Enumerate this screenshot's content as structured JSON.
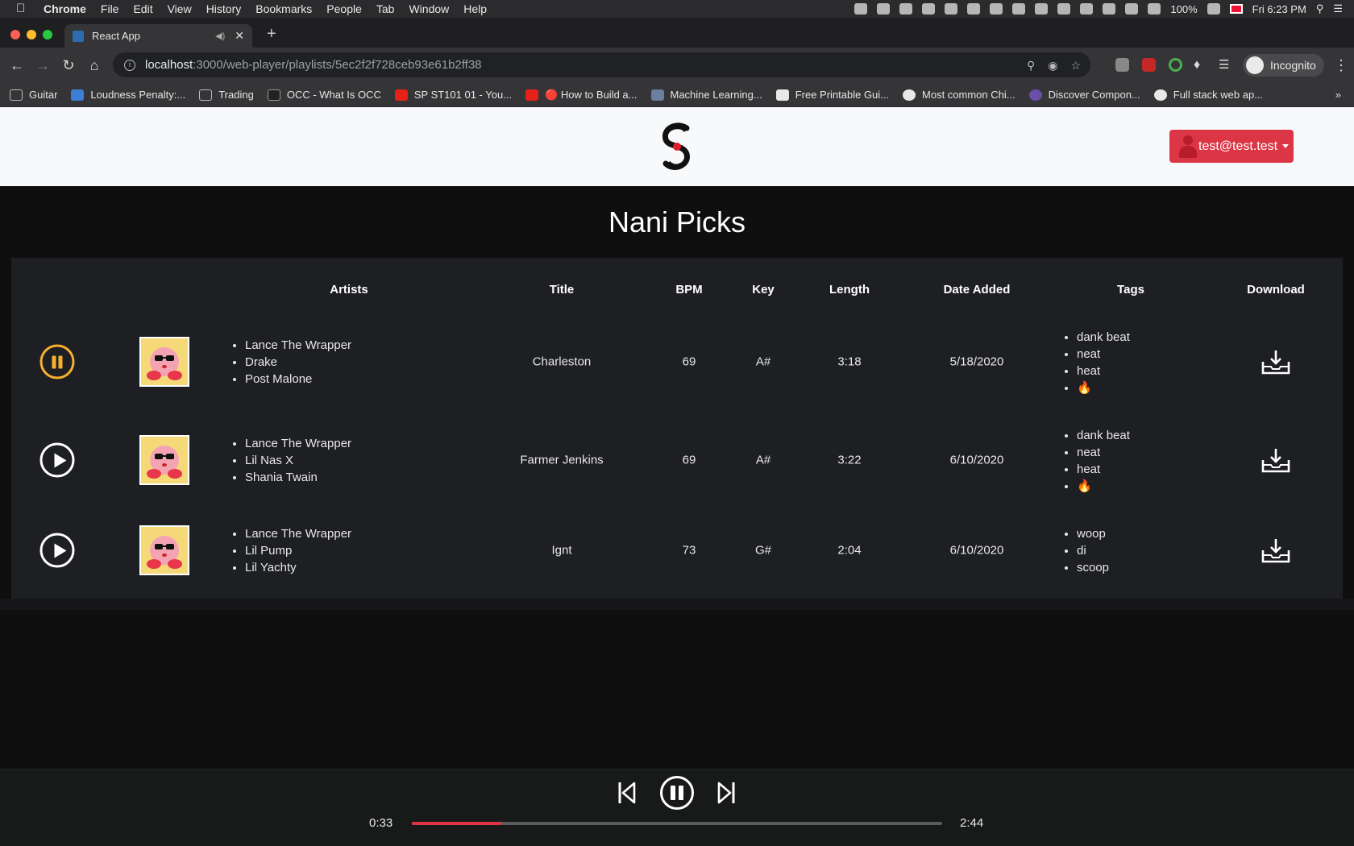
{
  "macos": {
    "app_name": "Chrome",
    "menu": [
      "File",
      "Edit",
      "View",
      "History",
      "Bookmarks",
      "People",
      "Tab",
      "Window",
      "Help"
    ],
    "battery": "100%",
    "clock": "Fri 6:23 PM"
  },
  "browser": {
    "tab_title": "React App",
    "url_host": "localhost",
    "url_rest": ":3000/web-player/playlists/5ec2f2f728ceb93e61b2ff38",
    "profile_label": "Incognito",
    "bookmarks": [
      {
        "label": "Guitar",
        "color": "#8a8a8a"
      },
      {
        "label": "Loudness Penalty:...",
        "color": "#3d7fd6"
      },
      {
        "label": "Trading",
        "color": "#8a8a8a"
      },
      {
        "label": "OCC - What Is OCC",
        "color": "#222222"
      },
      {
        "label": "SP ST101 01 - You...",
        "color": "#e62117"
      },
      {
        "label": "🔴 How to Build a...",
        "color": "#e62117"
      },
      {
        "label": "Machine Learning...",
        "color": "#6b7fa0"
      },
      {
        "label": "Free Printable Gui...",
        "color": "#e8e8e8"
      },
      {
        "label": "Most common Chi...",
        "color": "#e8e8e8"
      },
      {
        "label": "Discover Compon...",
        "color": "#6a4fa8"
      },
      {
        "label": "Full stack web ap...",
        "color": "#e8e8e8"
      }
    ]
  },
  "header": {
    "user_label": "test@test.test",
    "accent": "#dc3545"
  },
  "playlist": {
    "title": "Nani Picks",
    "columns": {
      "artists": "Artists",
      "title": "Title",
      "bpm": "BPM",
      "key": "Key",
      "length": "Length",
      "date_added": "Date Added",
      "tags": "Tags",
      "download": "Download"
    },
    "tracks": [
      {
        "state": "playing",
        "artists": [
          "Lance The Wrapper",
          "Drake",
          "Post Malone"
        ],
        "title": "Charleston",
        "bpm": "69",
        "key": "A#",
        "length": "3:18",
        "date_added": "5/18/2020",
        "tags": [
          "dank beat",
          "neat",
          "heat",
          "🔥"
        ]
      },
      {
        "state": "paused",
        "artists": [
          "Lance The Wrapper",
          "Lil Nas X",
          "Shania Twain"
        ],
        "title": "Farmer Jenkins",
        "bpm": "69",
        "key": "A#",
        "length": "3:22",
        "date_added": "6/10/2020",
        "tags": [
          "dank beat",
          "neat",
          "heat",
          "🔥"
        ]
      },
      {
        "state": "paused",
        "artists": [
          "Lance The Wrapper",
          "Lil Pump",
          "Lil Yachty"
        ],
        "title": "Ignt",
        "bpm": "73",
        "key": "G#",
        "length": "2:04",
        "date_added": "6/10/2020",
        "tags": [
          "woop",
          "di",
          "scoop"
        ]
      }
    ]
  },
  "player": {
    "elapsed": "0:33",
    "duration": "2:44",
    "progress_fraction": 0.17,
    "active_color": "#f5b031"
  }
}
